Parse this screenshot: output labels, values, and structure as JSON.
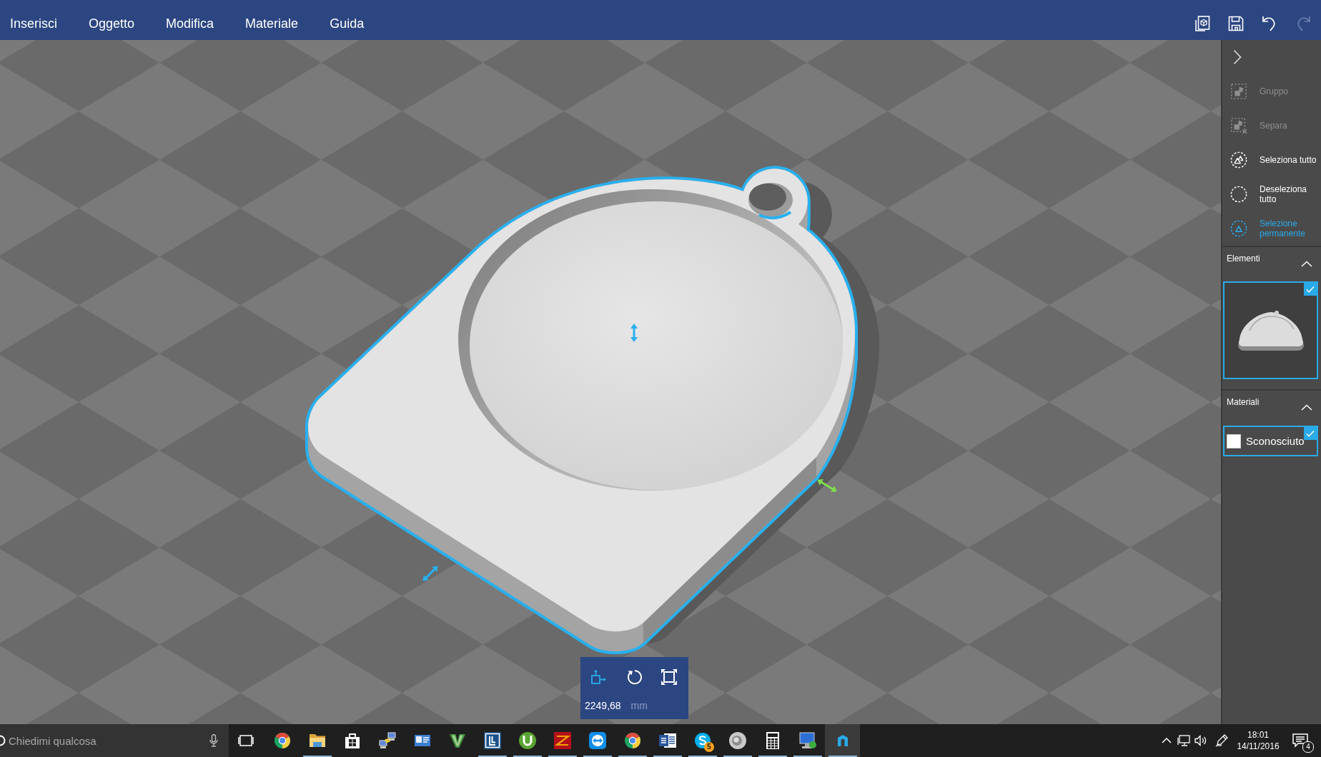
{
  "menu": [
    "Inserisci",
    "Oggetto",
    "Modifica",
    "Materiale",
    "Guida"
  ],
  "title_actions": [
    {
      "kind": "print3d",
      "disabled": false
    },
    {
      "kind": "save",
      "disabled": false
    },
    {
      "kind": "undo",
      "disabled": false
    },
    {
      "kind": "redo",
      "disabled": true
    }
  ],
  "side_panel": {
    "commands": [
      {
        "kind": "group",
        "label": "Gruppo",
        "disabled": true,
        "active": false
      },
      {
        "kind": "ungroup",
        "label": "Separa",
        "disabled": true,
        "active": false
      },
      {
        "kind": "select_all",
        "label": "Seleziona tutto",
        "disabled": false,
        "active": false
      },
      {
        "kind": "deselect_all",
        "label": "Deseleziona tutto",
        "disabled": false,
        "active": false
      },
      {
        "kind": "sticky_select",
        "label": "Selezione permanente",
        "disabled": false,
        "active": true
      }
    ],
    "elements": {
      "title": "Elementi",
      "expanded": true,
      "items": [
        {
          "kind": "model",
          "selected": true
        }
      ]
    },
    "materials": {
      "title": "Materiali",
      "expanded": true,
      "items": [
        {
          "label": "Sconosciuto",
          "color": "#ffffff",
          "selected": true
        }
      ]
    }
  },
  "transform_toolbar": {
    "tools": [
      {
        "kind": "move",
        "selected": true
      },
      {
        "kind": "rotate",
        "selected": false
      },
      {
        "kind": "scale",
        "selected": false
      }
    ],
    "value": "2249,68",
    "unit": "mm"
  },
  "taskbar": {
    "search": {
      "placeholder": "Chiedimi qualcosa"
    },
    "apps": [
      {
        "kind": "browser",
        "running": false,
        "selected": false
      },
      {
        "kind": "folder",
        "running": true,
        "selected": false
      },
      {
        "kind": "store",
        "running": false,
        "selected": false
      },
      {
        "kind": "network",
        "running": false,
        "selected": false
      },
      {
        "kind": "contacts",
        "running": false,
        "selected": false
      },
      {
        "kind": "v",
        "running": false,
        "selected": false
      },
      {
        "kind": "frame",
        "running": true,
        "selected": false
      },
      {
        "kind": "torrent",
        "running": true,
        "selected": false
      },
      {
        "kind": "ftp",
        "running": true,
        "selected": false
      },
      {
        "kind": "remote",
        "running": true,
        "selected": false
      },
      {
        "kind": "browser",
        "running": true,
        "selected": false
      },
      {
        "kind": "document",
        "running": true,
        "selected": false
      },
      {
        "kind": "chat",
        "running": true,
        "selected": false,
        "badge": "5"
      },
      {
        "kind": "speaker",
        "running": true,
        "selected": false
      },
      {
        "kind": "calculator",
        "running": true,
        "selected": false
      },
      {
        "kind": "desktop",
        "running": true,
        "selected": false
      },
      {
        "kind": "app",
        "running": true,
        "selected": true
      }
    ],
    "clock": {
      "time": "18:01",
      "date": "14/11/2016"
    },
    "notifications": {
      "badge": "4"
    }
  }
}
